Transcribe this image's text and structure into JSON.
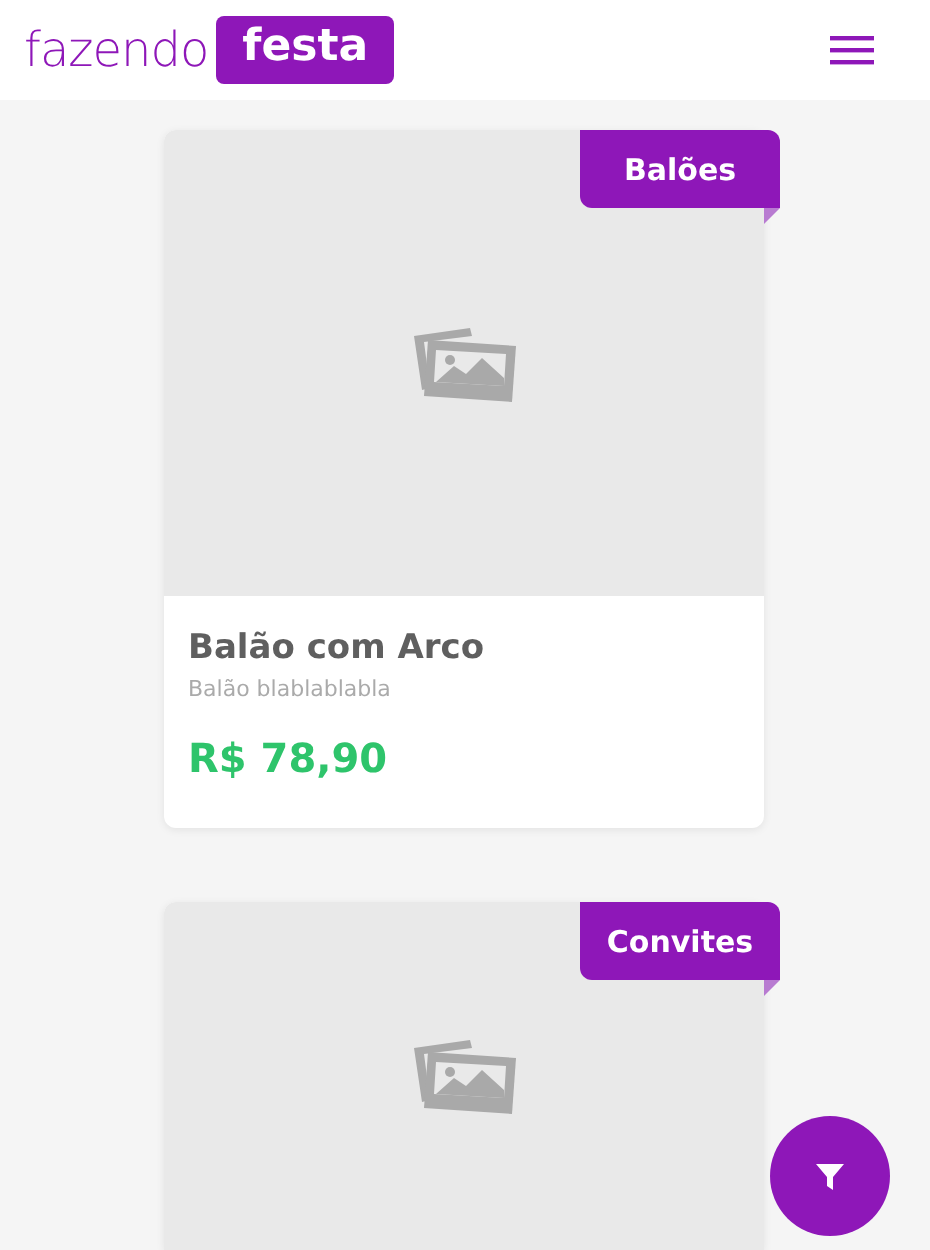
{
  "header": {
    "logo_light": "fazendo",
    "logo_bold": "festa"
  },
  "products": [
    {
      "category": "Balões",
      "name": "Balão com Arco",
      "description": "Balão blablablabla",
      "price": "R$ 78,90"
    },
    {
      "category": "Convites"
    }
  ]
}
